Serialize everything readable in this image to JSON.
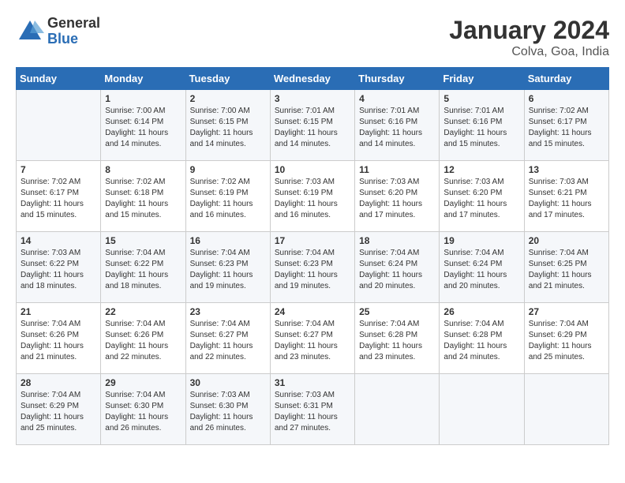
{
  "header": {
    "logo_general": "General",
    "logo_blue": "Blue",
    "title": "January 2024",
    "subtitle": "Colva, Goa, India"
  },
  "columns": [
    "Sunday",
    "Monday",
    "Tuesday",
    "Wednesday",
    "Thursday",
    "Friday",
    "Saturday"
  ],
  "weeks": [
    [
      {
        "day": "",
        "sunrise": "",
        "sunset": "",
        "daylight": ""
      },
      {
        "day": "1",
        "sunrise": "Sunrise: 7:00 AM",
        "sunset": "Sunset: 6:14 PM",
        "daylight": "Daylight: 11 hours and 14 minutes."
      },
      {
        "day": "2",
        "sunrise": "Sunrise: 7:00 AM",
        "sunset": "Sunset: 6:15 PM",
        "daylight": "Daylight: 11 hours and 14 minutes."
      },
      {
        "day": "3",
        "sunrise": "Sunrise: 7:01 AM",
        "sunset": "Sunset: 6:15 PM",
        "daylight": "Daylight: 11 hours and 14 minutes."
      },
      {
        "day": "4",
        "sunrise": "Sunrise: 7:01 AM",
        "sunset": "Sunset: 6:16 PM",
        "daylight": "Daylight: 11 hours and 14 minutes."
      },
      {
        "day": "5",
        "sunrise": "Sunrise: 7:01 AM",
        "sunset": "Sunset: 6:16 PM",
        "daylight": "Daylight: 11 hours and 15 minutes."
      },
      {
        "day": "6",
        "sunrise": "Sunrise: 7:02 AM",
        "sunset": "Sunset: 6:17 PM",
        "daylight": "Daylight: 11 hours and 15 minutes."
      }
    ],
    [
      {
        "day": "7",
        "sunrise": "Sunrise: 7:02 AM",
        "sunset": "Sunset: 6:17 PM",
        "daylight": "Daylight: 11 hours and 15 minutes."
      },
      {
        "day": "8",
        "sunrise": "Sunrise: 7:02 AM",
        "sunset": "Sunset: 6:18 PM",
        "daylight": "Daylight: 11 hours and 15 minutes."
      },
      {
        "day": "9",
        "sunrise": "Sunrise: 7:02 AM",
        "sunset": "Sunset: 6:19 PM",
        "daylight": "Daylight: 11 hours and 16 minutes."
      },
      {
        "day": "10",
        "sunrise": "Sunrise: 7:03 AM",
        "sunset": "Sunset: 6:19 PM",
        "daylight": "Daylight: 11 hours and 16 minutes."
      },
      {
        "day": "11",
        "sunrise": "Sunrise: 7:03 AM",
        "sunset": "Sunset: 6:20 PM",
        "daylight": "Daylight: 11 hours and 17 minutes."
      },
      {
        "day": "12",
        "sunrise": "Sunrise: 7:03 AM",
        "sunset": "Sunset: 6:20 PM",
        "daylight": "Daylight: 11 hours and 17 minutes."
      },
      {
        "day": "13",
        "sunrise": "Sunrise: 7:03 AM",
        "sunset": "Sunset: 6:21 PM",
        "daylight": "Daylight: 11 hours and 17 minutes."
      }
    ],
    [
      {
        "day": "14",
        "sunrise": "Sunrise: 7:03 AM",
        "sunset": "Sunset: 6:22 PM",
        "daylight": "Daylight: 11 hours and 18 minutes."
      },
      {
        "day": "15",
        "sunrise": "Sunrise: 7:04 AM",
        "sunset": "Sunset: 6:22 PM",
        "daylight": "Daylight: 11 hours and 18 minutes."
      },
      {
        "day": "16",
        "sunrise": "Sunrise: 7:04 AM",
        "sunset": "Sunset: 6:23 PM",
        "daylight": "Daylight: 11 hours and 19 minutes."
      },
      {
        "day": "17",
        "sunrise": "Sunrise: 7:04 AM",
        "sunset": "Sunset: 6:23 PM",
        "daylight": "Daylight: 11 hours and 19 minutes."
      },
      {
        "day": "18",
        "sunrise": "Sunrise: 7:04 AM",
        "sunset": "Sunset: 6:24 PM",
        "daylight": "Daylight: 11 hours and 20 minutes."
      },
      {
        "day": "19",
        "sunrise": "Sunrise: 7:04 AM",
        "sunset": "Sunset: 6:24 PM",
        "daylight": "Daylight: 11 hours and 20 minutes."
      },
      {
        "day": "20",
        "sunrise": "Sunrise: 7:04 AM",
        "sunset": "Sunset: 6:25 PM",
        "daylight": "Daylight: 11 hours and 21 minutes."
      }
    ],
    [
      {
        "day": "21",
        "sunrise": "Sunrise: 7:04 AM",
        "sunset": "Sunset: 6:26 PM",
        "daylight": "Daylight: 11 hours and 21 minutes."
      },
      {
        "day": "22",
        "sunrise": "Sunrise: 7:04 AM",
        "sunset": "Sunset: 6:26 PM",
        "daylight": "Daylight: 11 hours and 22 minutes."
      },
      {
        "day": "23",
        "sunrise": "Sunrise: 7:04 AM",
        "sunset": "Sunset: 6:27 PM",
        "daylight": "Daylight: 11 hours and 22 minutes."
      },
      {
        "day": "24",
        "sunrise": "Sunrise: 7:04 AM",
        "sunset": "Sunset: 6:27 PM",
        "daylight": "Daylight: 11 hours and 23 minutes."
      },
      {
        "day": "25",
        "sunrise": "Sunrise: 7:04 AM",
        "sunset": "Sunset: 6:28 PM",
        "daylight": "Daylight: 11 hours and 23 minutes."
      },
      {
        "day": "26",
        "sunrise": "Sunrise: 7:04 AM",
        "sunset": "Sunset: 6:28 PM",
        "daylight": "Daylight: 11 hours and 24 minutes."
      },
      {
        "day": "27",
        "sunrise": "Sunrise: 7:04 AM",
        "sunset": "Sunset: 6:29 PM",
        "daylight": "Daylight: 11 hours and 25 minutes."
      }
    ],
    [
      {
        "day": "28",
        "sunrise": "Sunrise: 7:04 AM",
        "sunset": "Sunset: 6:29 PM",
        "daylight": "Daylight: 11 hours and 25 minutes."
      },
      {
        "day": "29",
        "sunrise": "Sunrise: 7:04 AM",
        "sunset": "Sunset: 6:30 PM",
        "daylight": "Daylight: 11 hours and 26 minutes."
      },
      {
        "day": "30",
        "sunrise": "Sunrise: 7:03 AM",
        "sunset": "Sunset: 6:30 PM",
        "daylight": "Daylight: 11 hours and 26 minutes."
      },
      {
        "day": "31",
        "sunrise": "Sunrise: 7:03 AM",
        "sunset": "Sunset: 6:31 PM",
        "daylight": "Daylight: 11 hours and 27 minutes."
      },
      {
        "day": "",
        "sunrise": "",
        "sunset": "",
        "daylight": ""
      },
      {
        "day": "",
        "sunrise": "",
        "sunset": "",
        "daylight": ""
      },
      {
        "day": "",
        "sunrise": "",
        "sunset": "",
        "daylight": ""
      }
    ]
  ]
}
